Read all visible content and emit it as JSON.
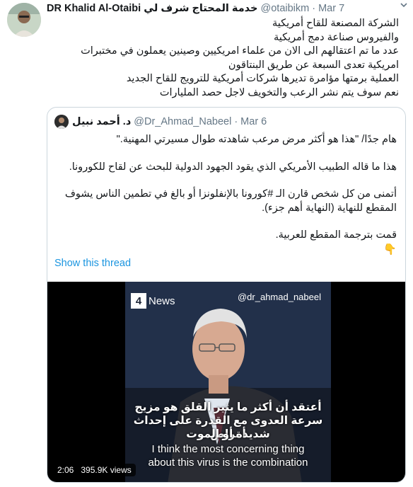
{
  "tweet": {
    "author_name": "DR Khalid Al-Otaibi",
    "author_tagline": "خدمة المحتاج شرف لي",
    "handle": "@otaibikm",
    "time": "Mar 7",
    "lines": [
      "الشركة المصنعة للقاح أمريكية",
      "والفيروس صناعة دمج أمريكية",
      "عدد ما تم اعتقالهم الى الان من علماء امريكيين وصينين يعملون في مختبرات",
      "امريكية تعدى السبعة عن طريق البنتاقون",
      "العملية برمتها مؤامرة تديرها شركات أمريكية للترويج للقاح الجديد",
      "نعم سوف يتم نشر الرعب والتخويف لاجل حصد المليارات"
    ]
  },
  "quoted": {
    "name": "د. أحمد نبيل",
    "handle": "@Dr_Ahmad_Nabeel",
    "time": "Mar 6",
    "para1": "هام جدًا/ \"هذا هو أكثر مرض مرعب شاهدته طوال مسيرتي المهنية.\"",
    "para2": "هذا ما قاله الطبيب الأمريكي الذي يقود الجهود الدولية للبحث عن لقاح للكورونا.",
    "para3_line1": "أتمنى من كل شخص قارن الـ #كورونا بالإنفلونزا أو بالغ في تطمين الناس يشوف",
    "para3_line2": "المقطع للنهاية (النهاية أهم جزء).",
    "para4": "قمت بترجمة المقطع للعربية.",
    "emoji": "👇",
    "show_thread": "Show this thread"
  },
  "video": {
    "channel_number": "4",
    "channel_name": "News",
    "watermark": "@dr_ahmad_nabeel",
    "subtitle_ar_1": "أعتقد أن أكثر ما يثير القلق هو مزيج",
    "subtitle_ar_2": "سرعة العدوى مع القدرة على إحداث أمراض",
    "subtitle_ar_3": "شديدة أو الموت",
    "subtitle_en_1": "I think the most concerning thing",
    "subtitle_en_2": "about this virus is the combination",
    "duration": "2:06",
    "views": "395.9K views"
  },
  "colors": {
    "text": "#14171a",
    "secondary": "#657786",
    "link": "#1b95e0",
    "border": "#ccd6dd"
  }
}
